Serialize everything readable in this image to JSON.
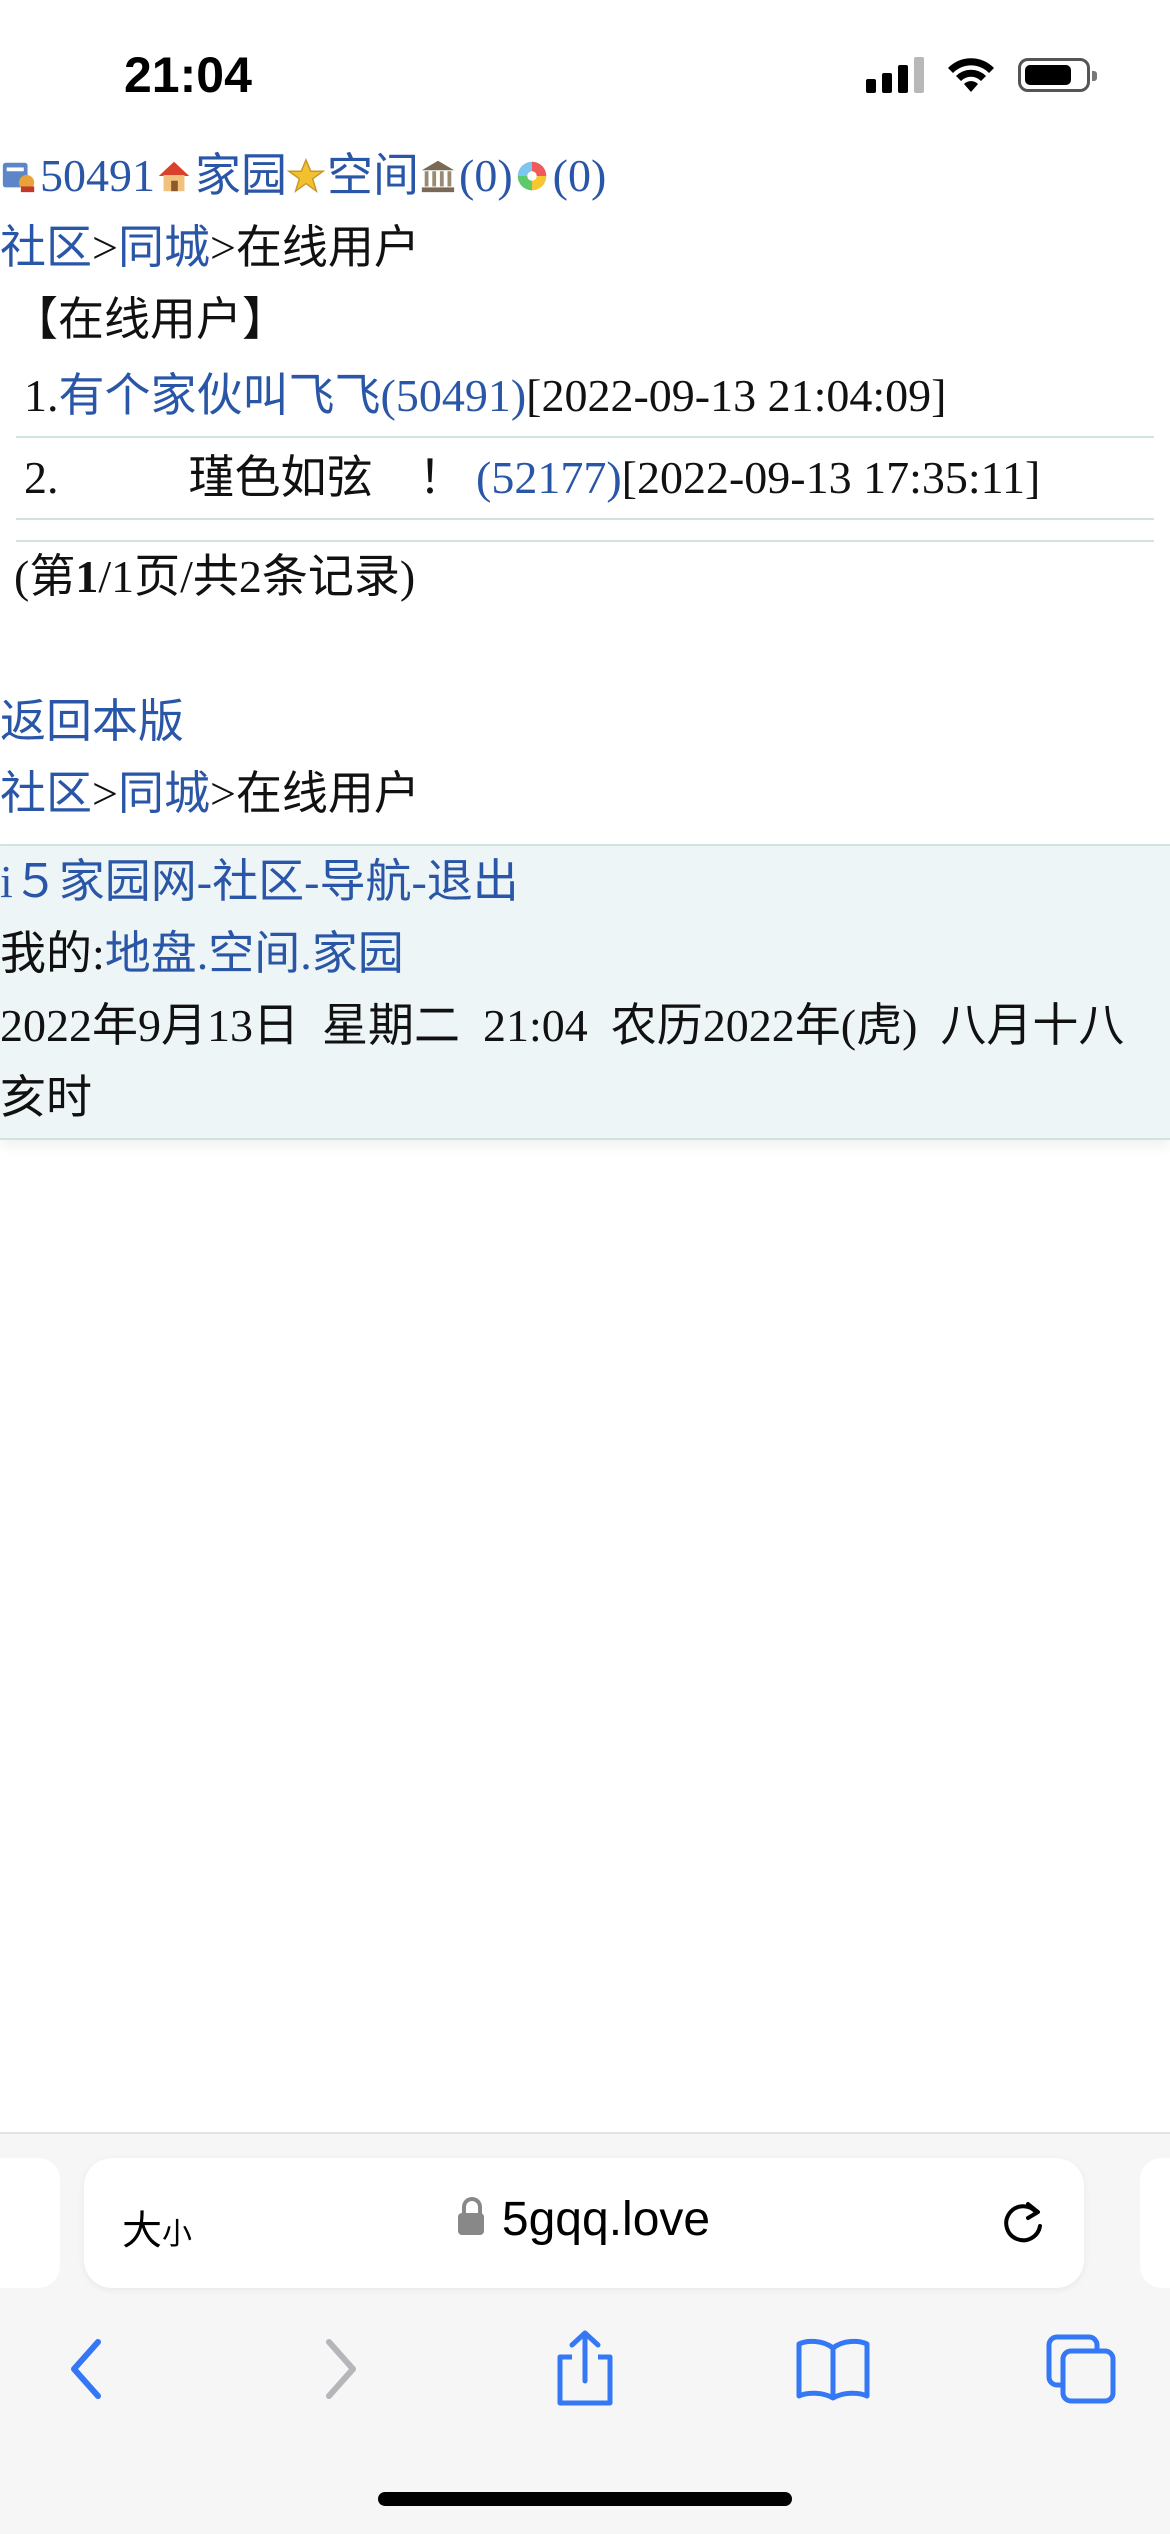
{
  "status": {
    "time": "21:04"
  },
  "top_links": {
    "uid": "50491",
    "home": "家园",
    "space": "空间",
    "count1": "(0)",
    "count2": "(0)"
  },
  "breadcrumb": {
    "community": "社区",
    "sep1": ">",
    "city": "同城",
    "sep2": ">",
    "current": "在线用户"
  },
  "page_title": "【在线用户】",
  "users": [
    {
      "index": "1.",
      "name": "有个家伙叫飞飞(50491)",
      "time": "[2022-09-13 21:04:09]"
    },
    {
      "index": "2.",
      "name": "瑾色如弦　！",
      "id": "(52177)",
      "time": "[2022-09-13 17:35:11]"
    }
  ],
  "pager": {
    "open": "(第",
    "page": "1",
    "rest": "/1页/共2条记录)"
  },
  "back_link": "返回本版",
  "breadcrumb_bottom": {
    "community": "社区",
    "sep1": ">",
    "city": "同城",
    "sep2": ">",
    "current": "在线用户"
  },
  "footer": {
    "site": "i５家园网",
    "dash1": "-",
    "community": "社区",
    "dash2": "-",
    "nav": "导航",
    "dash3": "-",
    "logout": "退出",
    "mine_label": "我的:",
    "land": "地盘",
    "dot1": ".",
    "space": "空间",
    "dot2": ".",
    "home": "家园",
    "date_line": "2022年9月13日  星期二  21:04  农历2022年(虎)  八月十八  亥时"
  },
  "browser": {
    "size_label": "大",
    "size_small": "小",
    "host": "5gqq.love"
  },
  "colors": {
    "link": "#2a56a8",
    "divider": "#cfe3df",
    "panel": "#eef5f6",
    "ios_blue": "#3478f6"
  }
}
